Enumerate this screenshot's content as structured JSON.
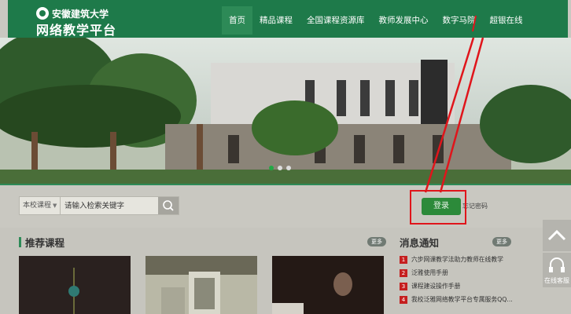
{
  "header": {
    "logo_top": "安徽建筑大学",
    "logo_bottom": "网络教学平台",
    "nav": [
      {
        "label": "首页",
        "active": true
      },
      {
        "label": "精品课程",
        "active": false
      },
      {
        "label": "全国课程资源库",
        "active": false
      },
      {
        "label": "教师发展中心",
        "active": false
      },
      {
        "label": "数字马院",
        "active": false
      },
      {
        "label": "超银在线",
        "active": false
      }
    ]
  },
  "banner": {
    "slides": 3,
    "active_slide": 1
  },
  "search": {
    "scope": "本校课程",
    "placeholder": "请输入检索关键字",
    "value": ""
  },
  "auth": {
    "login_label": "登录",
    "forgot_label": "忘记密码"
  },
  "recommended": {
    "title": "推荐课程",
    "more": "更多"
  },
  "news": {
    "title": "消息通知",
    "more": "更多",
    "items": [
      {
        "num": "1",
        "text": "六步网课教学法助力教师在线教学"
      },
      {
        "num": "2",
        "text": "泛雅使用手册"
      },
      {
        "num": "3",
        "text": "课程建设操作手册"
      },
      {
        "num": "4",
        "text": "我校泛雅网络教学平台专属服务QQ..."
      }
    ]
  },
  "side": {
    "help_label": "在线客服"
  },
  "colors": {
    "header": "#1e7a4a",
    "accent": "#2d8a57",
    "login": "#2c8a3a",
    "highlight": "#e0151b"
  }
}
